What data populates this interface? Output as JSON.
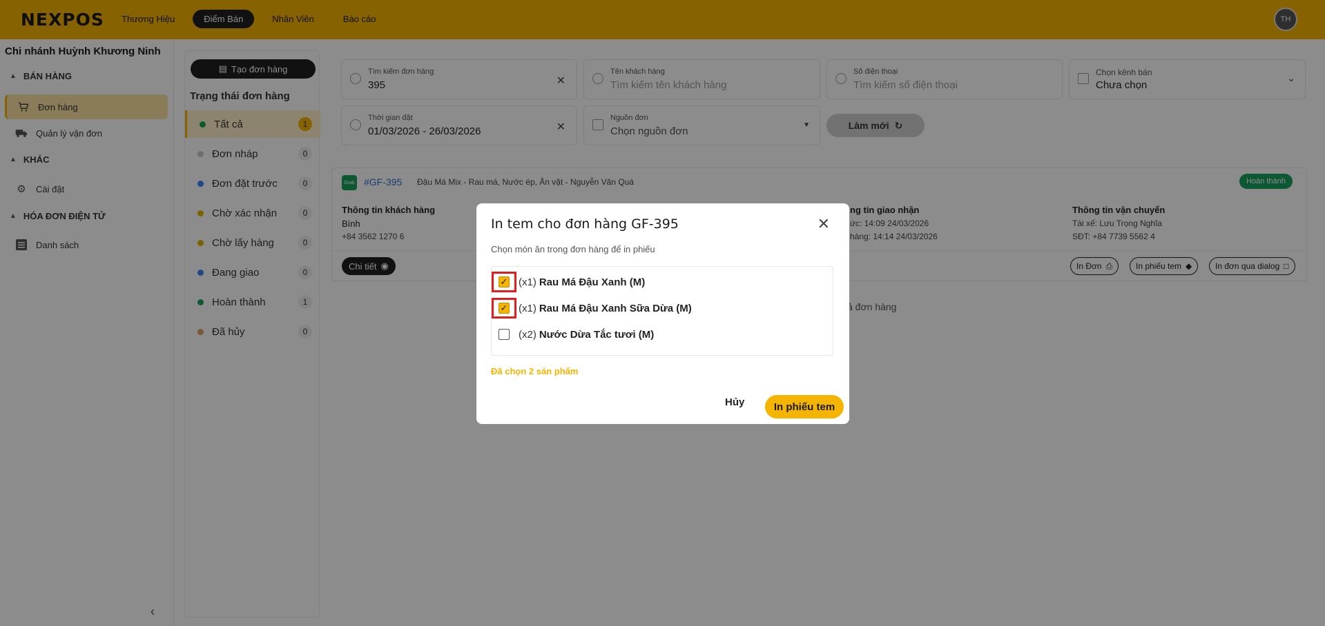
{
  "header": {
    "logo": "NEXPOS",
    "nav": [
      "Thương Hiệu",
      "Điểm Bán",
      "Nhân Viên",
      "Báo cáo"
    ],
    "active_nav": "Điểm Bán",
    "avatar": "TH"
  },
  "sidebar": {
    "branch": "Chi nhánh Huỳnh Khương Ninh",
    "sections": [
      {
        "title": "BÁN HÀNG",
        "items": [
          "Đơn hàng",
          "Quản lý vận đơn"
        ]
      },
      {
        "title": "KHÁC",
        "items": [
          "Cài đặt"
        ]
      },
      {
        "title": "HÓA ĐƠN ĐIỆN TỬ",
        "items": [
          "Danh sách"
        ]
      }
    ]
  },
  "status": {
    "create_label": "Tạo đơn hàng",
    "title": "Trạng thái đơn hàng",
    "items": [
      {
        "label": "Tất cả",
        "count": "1",
        "color": "#1aa05a"
      },
      {
        "label": "Đơn nháp",
        "count": "0",
        "color": "#c8c8c8"
      },
      {
        "label": "Đơn đặt trước",
        "count": "0",
        "color": "#3b82f6"
      },
      {
        "label": "Chờ xác nhận",
        "count": "0",
        "color": "#e0b400"
      },
      {
        "label": "Chờ lấy hàng",
        "count": "0",
        "color": "#e0b400"
      },
      {
        "label": "Đang giao",
        "count": "0",
        "color": "#3b82f6"
      },
      {
        "label": "Hoàn thành",
        "count": "1",
        "color": "#1aa05a"
      },
      {
        "label": "Đã hủy",
        "count": "0",
        "color": "#e0a060"
      }
    ]
  },
  "filters": {
    "order_search": {
      "label": "Tìm kiếm đơn hàng",
      "value": "395"
    },
    "customer": {
      "label": "Tên khách hàng",
      "placeholder": "Tìm kiếm tên khách hàng"
    },
    "phone": {
      "label": "Số điện thoại",
      "placeholder": "Tìm kiếm số điện thoại"
    },
    "channel": {
      "label": "Chọn kênh bán",
      "value": "Chưa chọn"
    },
    "time": {
      "label": "Thời gian đặt",
      "value": "01/03/2026 - 26/03/2026"
    },
    "source": {
      "label": "Nguồn đơn",
      "placeholder": "Chọn nguồn đơn"
    },
    "refresh_label": "Làm mới"
  },
  "order": {
    "badge": "Grab",
    "code": "#GF-395",
    "desc": "Đậu Má Mix - Rau má, Nước ép, Ăn vặt - Nguyễn Văn Quá",
    "status": "Hoàn thành",
    "customer_title": "Thông tin khách hàng",
    "customer_name": "Bình",
    "customer_phone": "+84 3562 1270 6",
    "delivery_title": "ng tin giao nhận",
    "delivery_line1": "ức: 14:09 24/03/2026",
    "delivery_line2": "hàng: 14:14 24/03/2026",
    "shipping_title": "Thông tin vận chuyển",
    "driver": "Tài xế: Lưu Trọng Nghĩa",
    "driver_phone": "SĐT: +84 7739 5562 4",
    "detail_label": "Chi tiết",
    "print_order": "In Đơn",
    "print_label": "In phiếu tem",
    "print_dialog": "In đơn qua dialog"
  },
  "empty_text": "ả đơn hàng",
  "modal": {
    "title": "In tem cho đơn hàng GF-395",
    "subtitle": "Chọn món ăn trong đơn hàng để in phiếu",
    "items": [
      {
        "qty": "(x1)",
        "name": "Rau Má Đậu Xanh (M)",
        "checked": true
      },
      {
        "qty": "(x1)",
        "name": "Rau Má Đậu Xanh Sữa Dừa (M)",
        "checked": true
      },
      {
        "qty": "(x2)",
        "name": "Nước Dừa Tắc tươi (M)",
        "checked": false
      }
    ],
    "selected_text": "Đã chọn 2 sản phẩm",
    "cancel_label": "Hủy",
    "print_label": "In phiếu tem"
  }
}
